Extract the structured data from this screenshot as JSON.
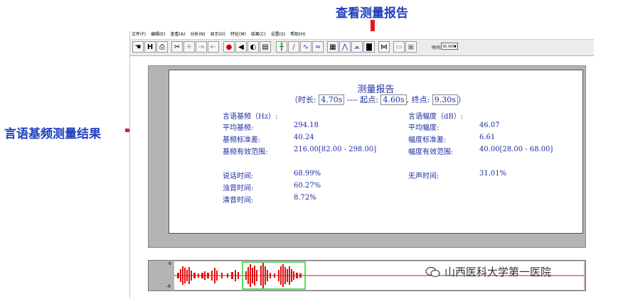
{
  "annotations": {
    "top": "查看测量报告",
    "left": "言语基频测量结果"
  },
  "menu": [
    "文件(F)",
    "编辑(E)",
    "查看(A)",
    "分析(N)",
    "显示(O)",
    "特征(M)",
    "结果(C)",
    "设置(S)",
    "帮助(H)"
  ],
  "toolbar": {
    "time_label": "时间",
    "time_value": "30.000"
  },
  "report": {
    "title": "测量报告",
    "duration_label": "（时长:",
    "duration_value": "4.70s",
    "start_label": "---- 起点:",
    "start_value": "4.60s",
    "end_label": "终点:",
    "end_value": "9.30s",
    "end_close": "）",
    "pitch": {
      "header": "言语基频（Hz）:",
      "rows": [
        {
          "label": "平均基频:",
          "value": "294.18"
        },
        {
          "label": "基频标准差:",
          "value": "40.24"
        },
        {
          "label": "基频有效范围:",
          "value": "216.00[82.00 - 298.00]"
        }
      ]
    },
    "amplitude": {
      "header": "言语幅度（dB）:",
      "rows": [
        {
          "label": "平均幅度:",
          "value": "46.07"
        },
        {
          "label": "幅度标准差:",
          "value": "6.61"
        },
        {
          "label": "幅度有效范围:",
          "value": "40.00[28.00 - 68.00]"
        }
      ]
    },
    "timing": {
      "rows": [
        {
          "label": "说话时间:",
          "value": "68.99%"
        },
        {
          "label": "浊音时间:",
          "value": "60.27%"
        },
        {
          "label": "清音时间:",
          "value": "8.72%"
        }
      ],
      "silence_label": "无声时间:",
      "silence_value": "31.01%"
    }
  },
  "waveform": {
    "scale_top": "6",
    "scale_bottom": "-6",
    "signal_color": "#e31010",
    "selection_color": "#2bd12b"
  },
  "watermark": "山西医科大学第一医院"
}
